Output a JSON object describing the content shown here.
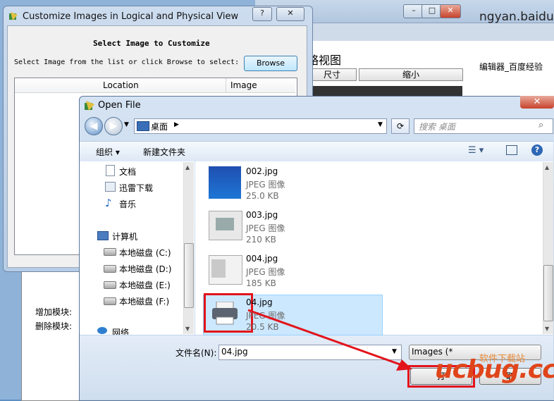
{
  "background_browser": {
    "address_fragment": "ngyan.baidu.co",
    "view_title": "略视图",
    "btn_size": "尺寸",
    "btn_shrink": "缩小",
    "right_link": "编辑器_百度经验"
  },
  "left_window": {
    "add_module": "增加模块:",
    "delete_module": "删除模块:"
  },
  "customize_window": {
    "title": "Customize Images in Logical and Physical View",
    "help_button": "?",
    "close_button": "✕",
    "heading": "Select Image to Customize",
    "instruction": "Select Image from the list or click Browse to select:",
    "browse_button": "Browse",
    "columns": [
      "Location",
      "Image"
    ]
  },
  "open_dialog": {
    "title": "Open File",
    "close_button": "✕",
    "breadcrumb": "桌面",
    "search_placeholder": "搜索 桌面",
    "toolbar": {
      "organize": "组织 ▾",
      "new_folder": "新建文件夹"
    },
    "nav_items": [
      {
        "label": "文档",
        "icon": "document-icon"
      },
      {
        "label": "迅雷下载",
        "icon": "download-icon"
      },
      {
        "label": "音乐",
        "icon": "music-icon"
      },
      {
        "label": "计算机",
        "icon": "computer-icon"
      },
      {
        "label": "本地磁盘 (C:)",
        "icon": "drive-icon"
      },
      {
        "label": "本地磁盘 (D:)",
        "icon": "drive-icon"
      },
      {
        "label": "本地磁盘 (E:)",
        "icon": "drive-icon"
      },
      {
        "label": "本地磁盘 (F:)",
        "icon": "drive-icon"
      },
      {
        "label": "网络",
        "icon": "network-icon"
      }
    ],
    "files": [
      {
        "name": "002.jpg",
        "type": "JPEG 图像",
        "size": "25.0 KB"
      },
      {
        "name": "003.jpg",
        "type": "JPEG 图像",
        "size": "210 KB"
      },
      {
        "name": "004.jpg",
        "type": "JPEG 图像",
        "size": "185 KB"
      },
      {
        "name": "04.jpg",
        "type": "JPEG 图像",
        "size": "20.5 KB"
      }
    ],
    "filename_label": "文件名(N):",
    "filename_value": "04.jpg",
    "filetype_value": "Images (*",
    "open_button": "打",
    "cancel_button": "取"
  },
  "watermark": {
    "logo": "ucbug.cc",
    "tagline": "软件下载站"
  },
  "colors": {
    "highlight": "#e2141b",
    "selection": "#cce8ff",
    "watermark": "#e0451a"
  }
}
